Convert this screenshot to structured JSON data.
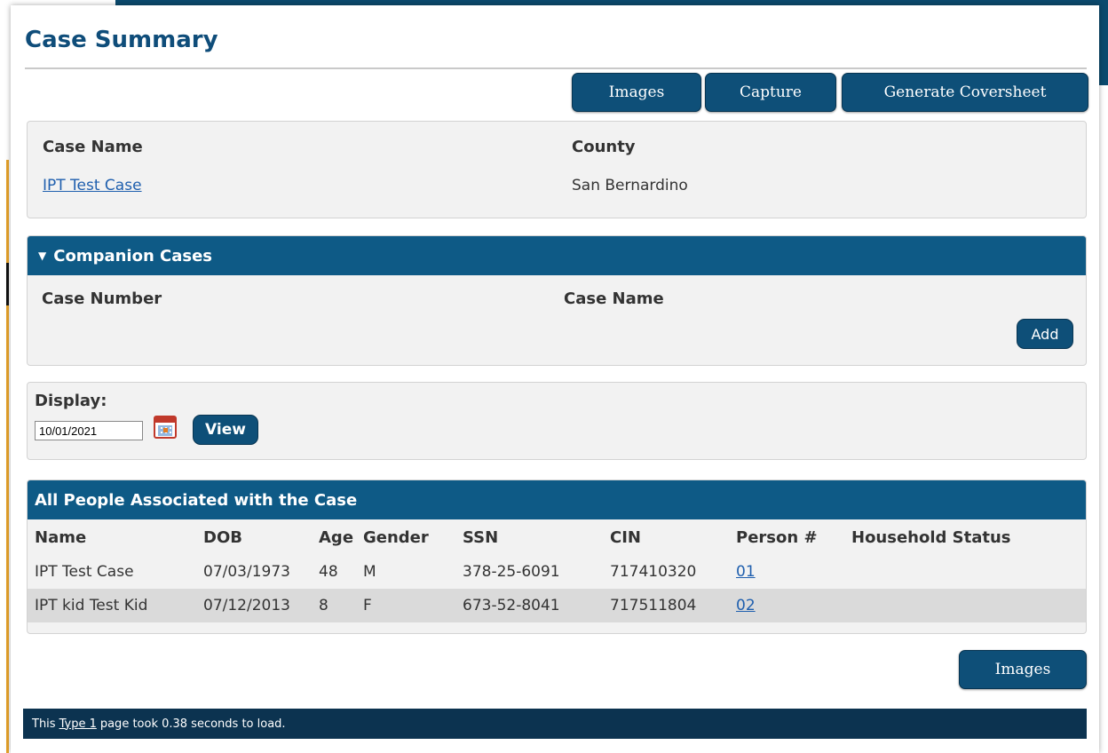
{
  "header": {
    "title": "Case Summary"
  },
  "toolbar": {
    "images_label": "Images",
    "capture_label": "Capture",
    "coversheet_label": "Generate Coversheet"
  },
  "case_info": {
    "case_name_label": "Case Name",
    "case_name_value": "IPT Test Case",
    "county_label": "County",
    "county_value": "San Bernardino"
  },
  "companion_cases": {
    "title": "Companion Cases",
    "col_case_number": "Case Number",
    "col_case_name": "Case Name",
    "add_label": "Add"
  },
  "display": {
    "label": "Display:",
    "date_value": "10/01/2021",
    "view_label": "View"
  },
  "people": {
    "title": "All People Associated with the Case",
    "columns": [
      "Name",
      "DOB",
      "Age",
      "Gender",
      "SSN",
      "CIN",
      "Person #",
      "Household Status"
    ],
    "rows": [
      [
        "IPT Test Case",
        "07/03/1973",
        "48",
        "M",
        "378-25-6091",
        "717410320",
        "01",
        ""
      ],
      [
        "IPT kid Test Kid",
        "07/12/2013",
        "8",
        "F",
        "673-52-8041",
        "717511804",
        "02",
        ""
      ]
    ]
  },
  "bottom": {
    "images_label": "Images"
  },
  "footer": {
    "prefix": "This",
    "link": "Type 1",
    "suffix": "page took 0.38 seconds to load."
  },
  "colors": {
    "primary": "#0e4f78",
    "header_bar": "#0e5a86",
    "footer_bar": "#0c3350",
    "title": "#0f4d7a",
    "link": "#1f5fae"
  }
}
